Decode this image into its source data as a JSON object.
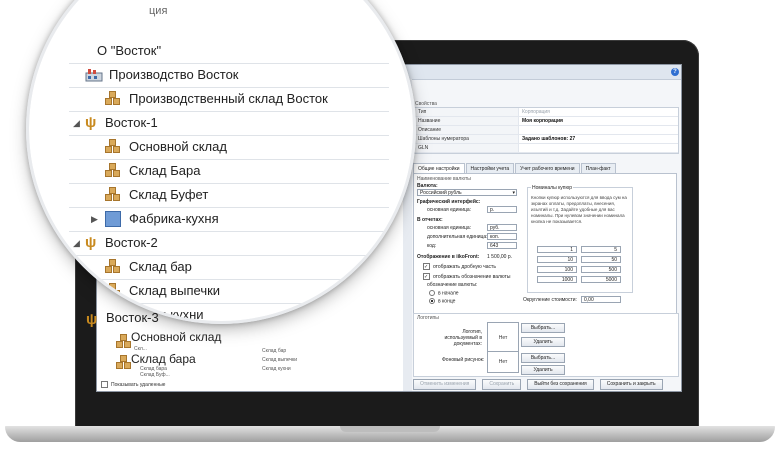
{
  "window": {
    "help_glyph": "?"
  },
  "left_panel": {
    "toolbar": {
      "back_glyph": "⇦",
      "forward_glyph": "⇨",
      "delete_glyph": "✕"
    },
    "rows_behind": [
      "Склад бар",
      "Склад выпечки",
      "Склад кухни"
    ],
    "show_deleted_label": "Показывать удаленные"
  },
  "zoom": {
    "partial_top": "ция",
    "items": [
      {
        "label": "О \"Восток\"",
        "icon": "none"
      },
      {
        "label": "Производство Восток",
        "icon": "factory-icon"
      },
      {
        "label": "Производственный склад Восток",
        "icon": "box-icon"
      },
      {
        "label": "Восток-1",
        "icon": "fork-icon",
        "expander": "◢"
      },
      {
        "label": "Основной склад",
        "icon": "box-icon"
      },
      {
        "label": "Склад Бара",
        "icon": "box-icon"
      },
      {
        "label": "Склад Буфет",
        "icon": "box-icon"
      },
      {
        "label": "Фабрика-кухня",
        "icon": "kitchen-icon",
        "expander": "▶"
      },
      {
        "label": "Восток-2",
        "icon": "fork-icon",
        "expander": "◢"
      },
      {
        "label": "Склад бар",
        "icon": "box-icon"
      },
      {
        "label": "Склад выпечки",
        "icon": "box-icon"
      },
      {
        "label": "Склад кухни",
        "icon": "box-icon"
      },
      {
        "label": "Восток-3",
        "icon": "fork-icon",
        "expander": "◢"
      },
      {
        "label": "Основной склад",
        "icon": "box-icon"
      },
      {
        "label": "Склад бара",
        "icon": "box-icon"
      }
    ],
    "under_rows": [
      "Скл...",
      "Склад бара",
      "Склад Буф..."
    ]
  },
  "properties": {
    "title": "Свойства",
    "rows": [
      {
        "key": "Тип",
        "value": "Корпорация",
        "style": "grey"
      },
      {
        "key": "Название",
        "value": "Моя корпорация",
        "style": "bold"
      },
      {
        "key": "Описание",
        "value": "",
        "style": ""
      },
      {
        "key": "Шаблоны нумератора",
        "value": "Задано шаблонов: 27",
        "style": "bold"
      },
      {
        "key": "GLN",
        "value": "",
        "style": ""
      }
    ]
  },
  "tabs": [
    "Общие настройки",
    "Настройки учета",
    "Учет рабочего времени",
    "План-факт"
  ],
  "general": {
    "currency_title": "Наименование валюты",
    "currency_label": "Валюта:",
    "currency_value": "Российский рубль",
    "gui_label": "Графический интерфейс:",
    "main_unit_label": "основная единица:",
    "main_unit_value": "р.",
    "reports_label": "В отчетах:",
    "rep_main_label": "основная единица:",
    "rep_main_value": "руб.",
    "rep_extra_label": "дополнительная единица:",
    "rep_extra_value": "коп.",
    "code_label": "код:",
    "code_value": "643",
    "display_label": "Отображение в iikoFront:",
    "display_value": "1 500,00 р.",
    "show_fraction_label": "отображать дробную часть",
    "show_symbol_label": "отображать обозначение валюты",
    "symbol_label": "обозначение валюты:",
    "radio_start": "в начале",
    "radio_end": "в конце",
    "denom_title": "Номиналы купюр",
    "denom_hint": "Кнопки купюр используются для ввода сум на экранах оплаты, предоплаты, внесения, изъятий и т.д. Задайте удобные для вас номиналы. При нулевом значении номинала кнопка не показывается.",
    "denoms_left": [
      "1",
      "10",
      "100",
      "1000"
    ],
    "denoms_right": [
      "5",
      "50",
      "500",
      "5000"
    ],
    "rounding_label": "Округление стоимости:",
    "rounding_value": "0,00"
  },
  "logos": {
    "title": "Логотипы",
    "doc_logo_label": "Логотип, используемый в документах:",
    "bg_label": "Фоновый рисунок:",
    "none_text": "Нет",
    "select_label": "Выбрать...",
    "delete_label": "Удалить"
  },
  "footer": {
    "cancel_changes": "Отменить изменения",
    "save": "Сохранить",
    "exit_no_save": "Выйти без сохранения",
    "save_close": "Сохранить и закрыть"
  }
}
